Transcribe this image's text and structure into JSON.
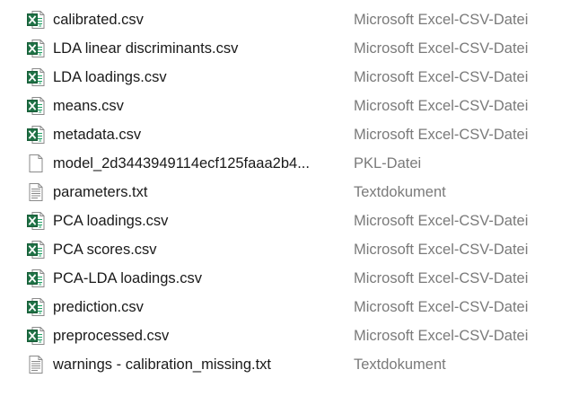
{
  "files": [
    {
      "name": "calibrated.csv",
      "type": "Microsoft Excel-CSV-Datei",
      "icon": "excel-csv-icon"
    },
    {
      "name": "LDA linear discriminants.csv",
      "type": "Microsoft Excel-CSV-Datei",
      "icon": "excel-csv-icon"
    },
    {
      "name": "LDA loadings.csv",
      "type": "Microsoft Excel-CSV-Datei",
      "icon": "excel-csv-icon"
    },
    {
      "name": "means.csv",
      "type": "Microsoft Excel-CSV-Datei",
      "icon": "excel-csv-icon"
    },
    {
      "name": "metadata.csv",
      "type": "Microsoft Excel-CSV-Datei",
      "icon": "excel-csv-icon"
    },
    {
      "name": "model_2d3443949114ecf125faaa2b4...",
      "type": "PKL-Datei",
      "icon": "blank-file-icon"
    },
    {
      "name": "parameters.txt",
      "type": "Textdokument",
      "icon": "text-document-icon"
    },
    {
      "name": "PCA loadings.csv",
      "type": "Microsoft Excel-CSV-Datei",
      "icon": "excel-csv-icon"
    },
    {
      "name": "PCA scores.csv",
      "type": "Microsoft Excel-CSV-Datei",
      "icon": "excel-csv-icon"
    },
    {
      "name": "PCA-LDA loadings.csv",
      "type": "Microsoft Excel-CSV-Datei",
      "icon": "excel-csv-icon"
    },
    {
      "name": "prediction.csv",
      "type": "Microsoft Excel-CSV-Datei",
      "icon": "excel-csv-icon"
    },
    {
      "name": "preprocessed.csv",
      "type": "Microsoft Excel-CSV-Datei",
      "icon": "excel-csv-icon"
    },
    {
      "name": "warnings - calibration_missing.txt",
      "type": "Textdokument",
      "icon": "text-document-icon"
    }
  ],
  "colors": {
    "excel_green": "#1e7145",
    "name_text": "#1a1a1a",
    "type_text": "#7a7a7a"
  }
}
